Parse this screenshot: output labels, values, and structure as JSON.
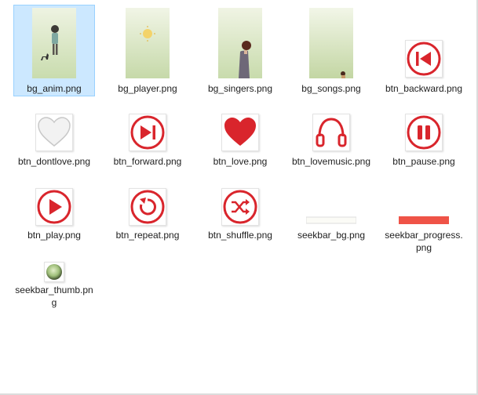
{
  "files": [
    {
      "name": "bg_anim.png",
      "icon": "bg-anim-thumbnail",
      "selected": true
    },
    {
      "name": "bg_player.png",
      "icon": "bg-player-thumbnail",
      "selected": false
    },
    {
      "name": "bg_singers.png",
      "icon": "bg-singers-thumbnail",
      "selected": false
    },
    {
      "name": "bg_songs.png",
      "icon": "bg-songs-thumbnail",
      "selected": false
    },
    {
      "name": "btn_backward.png",
      "icon": "backward-icon",
      "selected": false
    },
    {
      "name": "btn_dontlove.png",
      "icon": "gray-heart-icon",
      "selected": false
    },
    {
      "name": "btn_forward.png",
      "icon": "forward-icon",
      "selected": false
    },
    {
      "name": "btn_love.png",
      "icon": "red-heart-icon",
      "selected": false
    },
    {
      "name": "btn_lovemusic.png",
      "icon": "headphones-icon",
      "selected": false
    },
    {
      "name": "btn_pause.png",
      "icon": "pause-icon",
      "selected": false
    },
    {
      "name": "btn_play.png",
      "icon": "play-icon",
      "selected": false
    },
    {
      "name": "btn_repeat.png",
      "icon": "repeat-icon",
      "selected": false
    },
    {
      "name": "btn_shuffle.png",
      "icon": "shuffle-icon",
      "selected": false
    },
    {
      "name": "seekbar_bg.png",
      "icon": "seekbar-bg-thumbnail",
      "selected": false
    },
    {
      "name": "seekbar_progress.png",
      "icon": "seekbar-progress-thumbnail",
      "selected": false
    },
    {
      "name": "seekbar_thumb.png",
      "icon": "seekbar-thumb-icon",
      "selected": false
    }
  ],
  "colors": {
    "accent_red": "#d9252c",
    "selection_bg": "#cce8ff",
    "selection_border": "#99d1ff",
    "green_bg": "#d7e6bf"
  }
}
